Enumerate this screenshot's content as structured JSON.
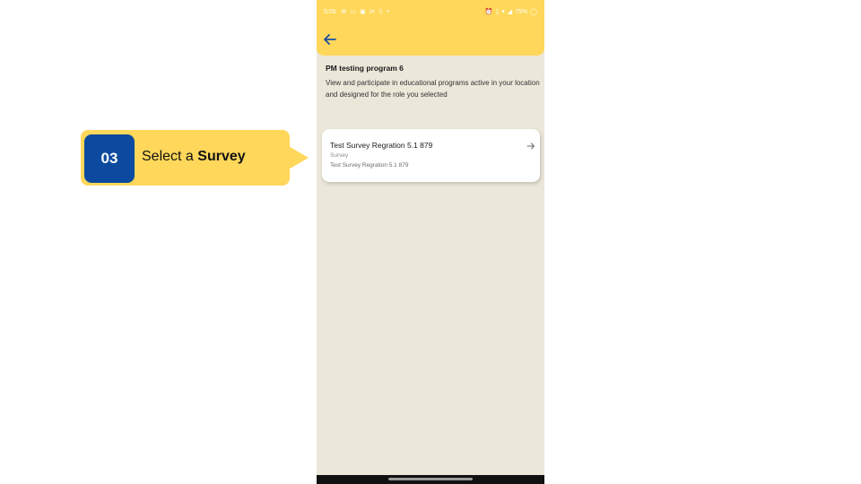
{
  "callout": {
    "step_number": "03",
    "text_prefix": "Select a ",
    "text_bold": "Survey"
  },
  "status_bar": {
    "time": "5:05",
    "battery": "75%"
  },
  "program": {
    "title": "PM testing program 6",
    "description": "View and participate in educational programs active in your location and designed for the role you selected"
  },
  "survey_card": {
    "title": "Test Survey Regration 5.1 879",
    "type": "Survey",
    "subtitle": "Test Survey Regration 5.1 879"
  },
  "colors": {
    "accent_yellow": "#ffd75a",
    "badge_blue": "#0b4a9e",
    "screen_bg": "#ebe7d9"
  },
  "icons": {
    "back": "arrow-left-icon",
    "card_action": "arrow-right-icon"
  }
}
